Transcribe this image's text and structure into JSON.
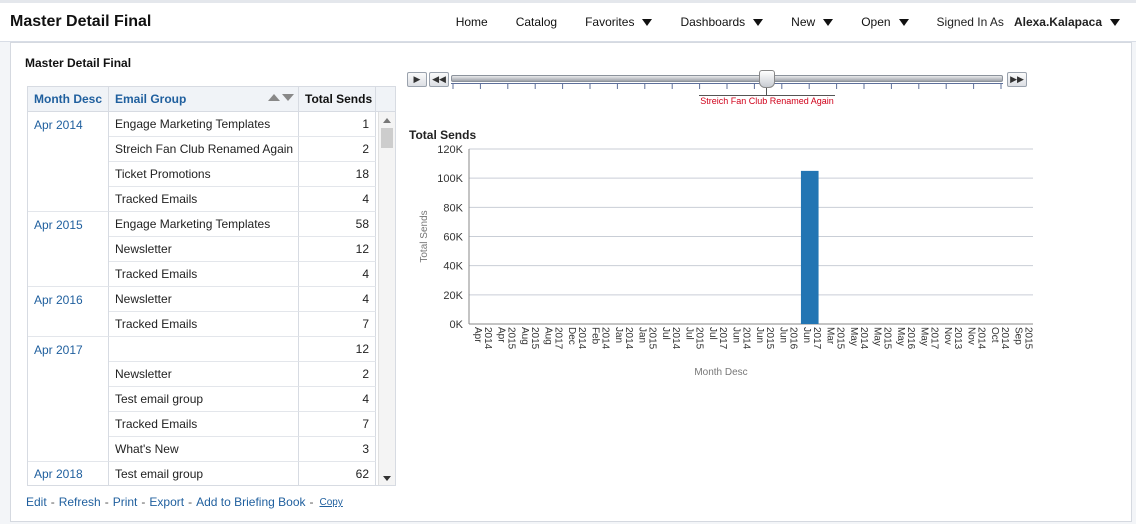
{
  "app": {
    "title": "Master Detail Final"
  },
  "nav": {
    "home": "Home",
    "catalog": "Catalog",
    "favorites": "Favorites",
    "dashboards": "Dashboards",
    "new": "New",
    "open": "Open",
    "signed_in_label": "Signed In As",
    "user": "Alexa.Kalapaca"
  },
  "panel": {
    "title": "Master Detail Final"
  },
  "table": {
    "headers": {
      "month": "Month Desc",
      "group": "Email Group",
      "sends": "Total Sends"
    },
    "rows": [
      {
        "month": "Apr 2014",
        "group": "Engage Marketing Templates",
        "sends": "1"
      },
      {
        "month": "",
        "group": "Streich Fan Club Renamed Again",
        "sends": "2"
      },
      {
        "month": "",
        "group": "Ticket Promotions",
        "sends": "18"
      },
      {
        "month": "",
        "group": "Tracked Emails",
        "sends": "4"
      },
      {
        "month": "Apr 2015",
        "group": "Engage Marketing Templates",
        "sends": "58"
      },
      {
        "month": "",
        "group": "Newsletter",
        "sends": "12"
      },
      {
        "month": "",
        "group": "Tracked Emails",
        "sends": "4"
      },
      {
        "month": "Apr 2016",
        "group": "Newsletter",
        "sends": "4"
      },
      {
        "month": "",
        "group": "Tracked Emails",
        "sends": "7"
      },
      {
        "month": "Apr 2017",
        "group": "",
        "sends": "12"
      },
      {
        "month": "",
        "group": "Newsletter",
        "sends": "2"
      },
      {
        "month": "",
        "group": "Test email group",
        "sends": "4"
      },
      {
        "month": "",
        "group": "Tracked Emails",
        "sends": "7"
      },
      {
        "month": "",
        "group": "What's New",
        "sends": "3"
      },
      {
        "month": "Apr 2018",
        "group": "Test email group",
        "sends": "62"
      }
    ]
  },
  "links": {
    "edit": "Edit",
    "refresh": "Refresh",
    "print": "Print",
    "export": "Export",
    "briefing": "Add to Briefing Book",
    "copy": "Copy",
    "sep": "-"
  },
  "slider": {
    "selected_label": "Streich Fan Club Renamed Again",
    "play_icon": "play-icon",
    "back_icon": "rewind-icon",
    "end_icon": "fast-forward-icon",
    "position": 0.56
  },
  "colors": {
    "bar": "#2275b3",
    "link": "#1f5f9e",
    "slider_label": "#d0021b"
  },
  "chart_data": {
    "type": "bar",
    "title": "Total Sends",
    "xlabel": "Month Desc",
    "ylabel": "Total Sends",
    "ylim": [
      0,
      120000
    ],
    "yticks": [
      "0K",
      "20K",
      "40K",
      "60K",
      "80K",
      "100K",
      "120K"
    ],
    "grid": true,
    "categories": [
      "Apr 2014",
      "Apr 2015",
      "Aug 2015",
      "Aug 2017",
      "Dec 2014",
      "Feb 2014",
      "Jan 2014",
      "Jan 2015",
      "Jul 2014",
      "Jul 2015",
      "Jul 2017",
      "Jun 2014",
      "Jun 2015",
      "Jun 2016",
      "Jun 2017",
      "Mar 2015",
      "May 2014",
      "May 2015",
      "May 2016",
      "May 2017",
      "Nov 2013",
      "Nov 2014",
      "Oct 2014",
      "Sep 2015"
    ],
    "values": [
      0,
      0,
      0,
      0,
      0,
      0,
      0,
      0,
      0,
      0,
      0,
      0,
      0,
      0,
      105000,
      0,
      0,
      0,
      0,
      0,
      0,
      0,
      0,
      0
    ]
  }
}
